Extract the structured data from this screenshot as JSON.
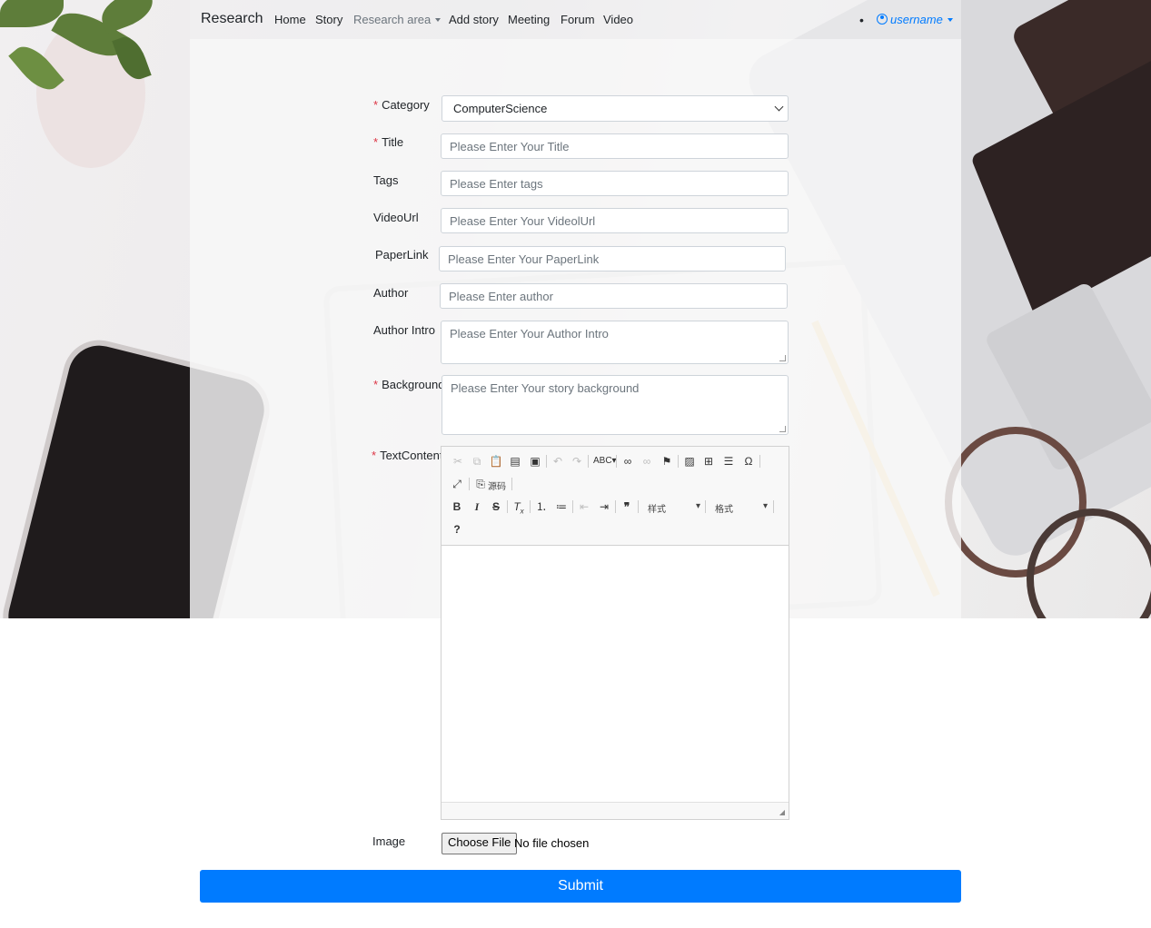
{
  "nav": {
    "brand": "Research",
    "items": [
      {
        "label": "Home"
      },
      {
        "label": "Story"
      },
      {
        "label": "Research area"
      },
      {
        "label": "Add story"
      },
      {
        "label": "Meeting"
      },
      {
        "label": "Forum"
      },
      {
        "label": "Video"
      }
    ],
    "bullet": "•",
    "user": "username"
  },
  "form": {
    "required_mark": "*",
    "category": {
      "label": "Category",
      "value": "ComputerScience"
    },
    "title": {
      "label": "Title",
      "placeholder": "Please Enter Your Title"
    },
    "tags": {
      "label": "Tags",
      "placeholder": "Please Enter tags"
    },
    "video_url": {
      "label": "VideoUrl",
      "placeholder": "Please Enter Your VideolUrl"
    },
    "paper_link": {
      "label": "PaperLink",
      "placeholder": "Please Enter Your PaperLink"
    },
    "author": {
      "label": "Author",
      "placeholder": "Please Enter author"
    },
    "author_intro": {
      "label": "Author Intro",
      "placeholder": "Please Enter Your Author Intro"
    },
    "background": {
      "label": "Background",
      "placeholder": "Please Enter Your story background"
    },
    "text_content": {
      "label": "TextContent"
    },
    "editor": {
      "source_label": "源码",
      "style_label": "样式",
      "format_label": "格式",
      "help": "?"
    },
    "image": {
      "label": "Image",
      "button": "Choose File",
      "status": "No file chosen"
    },
    "submit": "Submit"
  },
  "colors": {
    "accent": "#007bff",
    "required": "#dc3545"
  }
}
